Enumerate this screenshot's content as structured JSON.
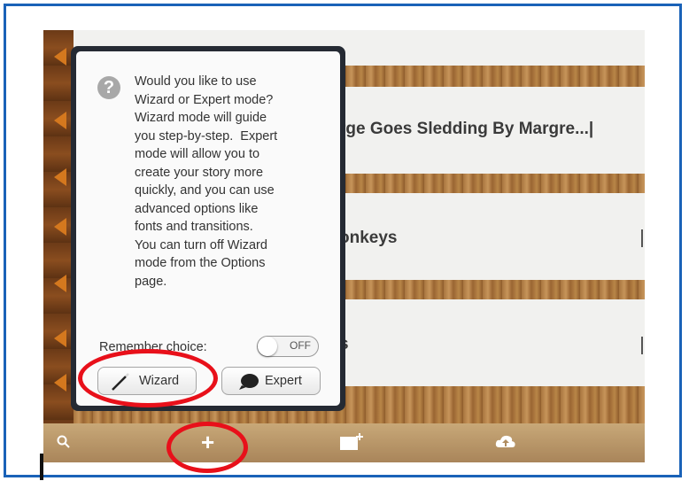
{
  "rows": [
    {
      "title": "rge Goes Sledding By Margre...|"
    },
    {
      "title": "onkeys"
    },
    {
      "title": "s"
    }
  ],
  "popup": {
    "message_lines": [
      "Would you like to use",
      "Wizard or Expert mode?",
      "Wizard mode will guide",
      "you step-by-step.  Expert",
      "mode will allow you to",
      "create your story more",
      "quickly, and you can use",
      "advanced options like",
      "fonts and transitions.",
      "You can turn off Wizard",
      "mode from the Options",
      "page."
    ],
    "remember_label": "Remember choice:",
    "toggle_state": "OFF",
    "wizard_label": "Wizard",
    "expert_label": "Expert"
  },
  "toolbar": {
    "icons": [
      "search-icon",
      "add-icon",
      "new-page-icon",
      "cloud-upload-icon"
    ],
    "add_label": "+"
  },
  "colors": {
    "frame_border": "#1a62b8",
    "highlight_ring": "#e8101a",
    "popup_border": "#252a33"
  }
}
